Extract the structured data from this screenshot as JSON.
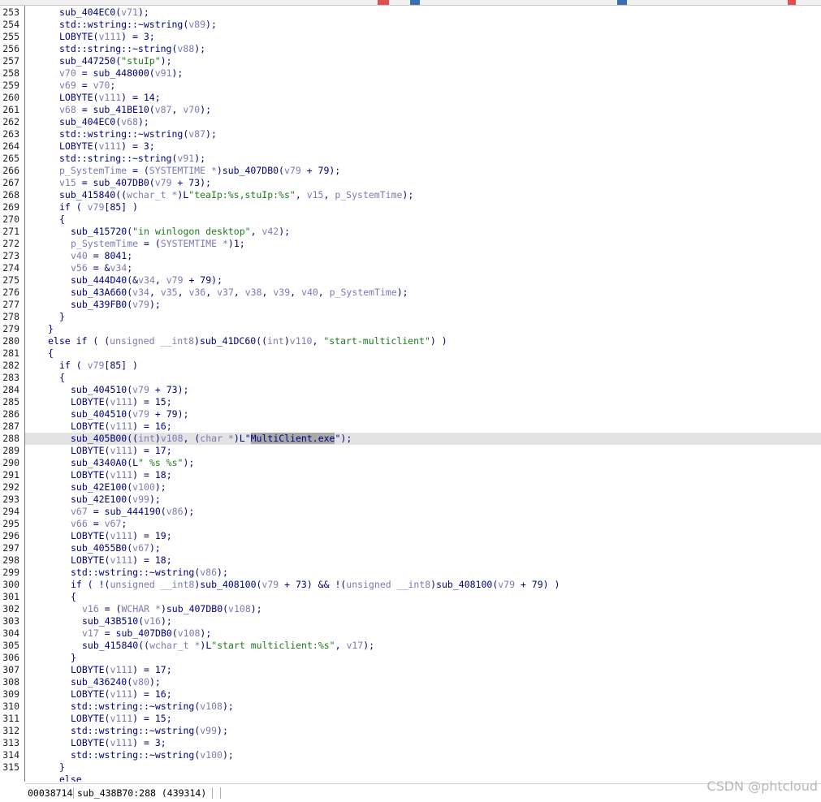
{
  "status": {
    "address": "00038714",
    "location": "sub_438B70:288 (439314)"
  },
  "watermark": "CSDN @phtcloud",
  "lines": [
    {
      "n": "253",
      "indent": 6,
      "toks": [
        [
          "fn",
          "sub_404EC0("
        ],
        [
          "var",
          "v71"
        ],
        [
          "op",
          ");"
        ]
      ]
    },
    {
      "n": "254",
      "indent": 6,
      "toks": [
        [
          "fn",
          "std::wstring::~wstring("
        ],
        [
          "var",
          "v89"
        ],
        [
          "op",
          ");"
        ]
      ]
    },
    {
      "n": "255",
      "indent": 6,
      "toks": [
        [
          "fn",
          "LOBYTE("
        ],
        [
          "var",
          "v111"
        ],
        [
          "op",
          ") = 3;"
        ]
      ]
    },
    {
      "n": "256",
      "indent": 6,
      "toks": [
        [
          "fn",
          "std::string::~string("
        ],
        [
          "var",
          "v88"
        ],
        [
          "op",
          ");"
        ]
      ]
    },
    {
      "n": "257",
      "indent": 6,
      "toks": [
        [
          "fn",
          "sub_447250("
        ],
        [
          "str",
          "\"stuIp\""
        ],
        [
          "op",
          ");"
        ]
      ]
    },
    {
      "n": "258",
      "indent": 6,
      "toks": [
        [
          "var",
          "v70"
        ],
        [
          "op",
          " = sub_448000("
        ],
        [
          "var",
          "v91"
        ],
        [
          "op",
          ");"
        ]
      ]
    },
    {
      "n": "259",
      "indent": 6,
      "toks": [
        [
          "var",
          "v69"
        ],
        [
          "op",
          " = "
        ],
        [
          "var",
          "v70"
        ],
        [
          "op",
          ";"
        ]
      ]
    },
    {
      "n": "260",
      "indent": 6,
      "toks": [
        [
          "fn",
          "LOBYTE("
        ],
        [
          "var",
          "v111"
        ],
        [
          "op",
          ") = 14;"
        ]
      ]
    },
    {
      "n": "261",
      "indent": 6,
      "toks": [
        [
          "var",
          "v68"
        ],
        [
          "op",
          " = sub_41BE10("
        ],
        [
          "var",
          "v87"
        ],
        [
          "op",
          ", "
        ],
        [
          "var",
          "v70"
        ],
        [
          "op",
          ");"
        ]
      ]
    },
    {
      "n": "262",
      "indent": 6,
      "toks": [
        [
          "fn",
          "sub_404EC0("
        ],
        [
          "var",
          "v68"
        ],
        [
          "op",
          ");"
        ]
      ]
    },
    {
      "n": "263",
      "indent": 6,
      "toks": [
        [
          "fn",
          "std::wstring::~wstring("
        ],
        [
          "var",
          "v87"
        ],
        [
          "op",
          ");"
        ]
      ]
    },
    {
      "n": "264",
      "indent": 6,
      "toks": [
        [
          "fn",
          "LOBYTE("
        ],
        [
          "var",
          "v111"
        ],
        [
          "op",
          ") = 3;"
        ]
      ]
    },
    {
      "n": "265",
      "indent": 6,
      "toks": [
        [
          "fn",
          "std::string::~string("
        ],
        [
          "var",
          "v91"
        ],
        [
          "op",
          ");"
        ]
      ]
    },
    {
      "n": "266",
      "indent": 6,
      "toks": [
        [
          "var",
          "p_SystemTime"
        ],
        [
          "op",
          " = ("
        ],
        [
          "type",
          "SYSTEMTIME *"
        ],
        [
          "op",
          ")sub_407DB0("
        ],
        [
          "var",
          "v79"
        ],
        [
          "op",
          " + 79);"
        ]
      ]
    },
    {
      "n": "267",
      "indent": 6,
      "toks": [
        [
          "var",
          "v15"
        ],
        [
          "op",
          " = sub_407DB0("
        ],
        [
          "var",
          "v79"
        ],
        [
          "op",
          " + 73);"
        ]
      ]
    },
    {
      "n": "268",
      "indent": 6,
      "toks": [
        [
          "fn",
          "sub_415840(("
        ],
        [
          "type",
          "wchar_t *"
        ],
        [
          "op",
          ")L"
        ],
        [
          "str",
          "\"teaIp:%s,stuIp:%s\""
        ],
        [
          "op",
          ", "
        ],
        [
          "var",
          "v15"
        ],
        [
          "op",
          ", "
        ],
        [
          "var",
          "p_SystemTime"
        ],
        [
          "op",
          ");"
        ]
      ]
    },
    {
      "n": "269",
      "indent": 6,
      "toks": [
        [
          "kw",
          "if ( "
        ],
        [
          "var",
          "v79"
        ],
        [
          "op",
          "[85] )"
        ]
      ]
    },
    {
      "n": "270",
      "indent": 6,
      "toks": [
        [
          "op",
          "{"
        ]
      ]
    },
    {
      "n": "271",
      "indent": 8,
      "toks": [
        [
          "fn",
          "sub_415720("
        ],
        [
          "str",
          "\"in winlogon desktop\""
        ],
        [
          "op",
          ", "
        ],
        [
          "var",
          "v42"
        ],
        [
          "op",
          ");"
        ]
      ]
    },
    {
      "n": "272",
      "indent": 8,
      "toks": [
        [
          "var",
          "p_SystemTime"
        ],
        [
          "op",
          " = ("
        ],
        [
          "type",
          "SYSTEMTIME *"
        ],
        [
          "op",
          ")1;"
        ]
      ]
    },
    {
      "n": "273",
      "indent": 8,
      "toks": [
        [
          "var",
          "v40"
        ],
        [
          "op",
          " = 8041;"
        ]
      ]
    },
    {
      "n": "274",
      "indent": 8,
      "toks": [
        [
          "var",
          "v56"
        ],
        [
          "op",
          " = &"
        ],
        [
          "var",
          "v34"
        ],
        [
          "op",
          ";"
        ]
      ]
    },
    {
      "n": "275",
      "indent": 8,
      "toks": [
        [
          "fn",
          "sub_444D40(&"
        ],
        [
          "var",
          "v34"
        ],
        [
          "op",
          ", "
        ],
        [
          "var",
          "v79"
        ],
        [
          "op",
          " + 79);"
        ]
      ]
    },
    {
      "n": "276",
      "indent": 8,
      "toks": [
        [
          "fn",
          "sub_43A660("
        ],
        [
          "var",
          "v34"
        ],
        [
          "op",
          ", "
        ],
        [
          "var",
          "v35"
        ],
        [
          "op",
          ", "
        ],
        [
          "var",
          "v36"
        ],
        [
          "op",
          ", "
        ],
        [
          "var",
          "v37"
        ],
        [
          "op",
          ", "
        ],
        [
          "var",
          "v38"
        ],
        [
          "op",
          ", "
        ],
        [
          "var",
          "v39"
        ],
        [
          "op",
          ", "
        ],
        [
          "var",
          "v40"
        ],
        [
          "op",
          ", "
        ],
        [
          "var",
          "p_SystemTime"
        ],
        [
          "op",
          ");"
        ]
      ]
    },
    {
      "n": "277",
      "indent": 8,
      "toks": [
        [
          "fn",
          "sub_439FB0("
        ],
        [
          "var",
          "v79"
        ],
        [
          "op",
          ");"
        ]
      ]
    },
    {
      "n": "278",
      "indent": 6,
      "toks": [
        [
          "op",
          "}"
        ]
      ]
    },
    {
      "n": "279",
      "indent": 4,
      "toks": [
        [
          "op",
          "}"
        ]
      ]
    },
    {
      "n": "280",
      "indent": 4,
      "toks": [
        [
          "kw",
          "else if ( ("
        ],
        [
          "type",
          "unsigned __int8"
        ],
        [
          "op",
          ")sub_41DC60(("
        ],
        [
          "type",
          "int"
        ],
        [
          "op",
          ")"
        ],
        [
          "var",
          "v110"
        ],
        [
          "op",
          ", "
        ],
        [
          "str",
          "\"start-multiclient\""
        ],
        [
          "op",
          ") )"
        ]
      ]
    },
    {
      "n": "281",
      "indent": 4,
      "toks": [
        [
          "op",
          "{"
        ]
      ]
    },
    {
      "n": "282",
      "indent": 6,
      "toks": [
        [
          "kw",
          "if ( "
        ],
        [
          "var",
          "v79"
        ],
        [
          "op",
          "[85] )"
        ]
      ]
    },
    {
      "n": "283",
      "indent": 6,
      "toks": [
        [
          "op",
          "{"
        ]
      ]
    },
    {
      "n": "284",
      "indent": 8,
      "toks": [
        [
          "fn",
          "sub_404510("
        ],
        [
          "var",
          "v79"
        ],
        [
          "op",
          " + 73);"
        ]
      ]
    },
    {
      "n": "285",
      "indent": 8,
      "toks": [
        [
          "fn",
          "LOBYTE("
        ],
        [
          "var",
          "v111"
        ],
        [
          "op",
          ") = 15;"
        ]
      ]
    },
    {
      "n": "286",
      "indent": 8,
      "toks": [
        [
          "fn",
          "sub_404510("
        ],
        [
          "var",
          "v79"
        ],
        [
          "op",
          " + 79);"
        ]
      ]
    },
    {
      "n": "287",
      "indent": 8,
      "toks": [
        [
          "fn",
          "LOBYTE("
        ],
        [
          "var",
          "v111"
        ],
        [
          "op",
          ") = 16;"
        ]
      ]
    },
    {
      "n": "288",
      "indent": 8,
      "cur": true,
      "toks": [
        [
          "fn",
          "sub_405B00(("
        ],
        [
          "type",
          "int"
        ],
        [
          "op",
          ")"
        ],
        [
          "var",
          "v108"
        ],
        [
          "op",
          ", ("
        ],
        [
          "type",
          "char *"
        ],
        [
          "op",
          ")L\""
        ],
        [
          "sel",
          "MultiClient.exe"
        ],
        [
          "op",
          "\");"
        ]
      ]
    },
    {
      "n": "289",
      "indent": 8,
      "toks": [
        [
          "fn",
          "LOBYTE("
        ],
        [
          "var",
          "v111"
        ],
        [
          "op",
          ") = 17;"
        ]
      ]
    },
    {
      "n": "290",
      "indent": 8,
      "toks": [
        [
          "fn",
          "sub_4340A0(L"
        ],
        [
          "str",
          "\" %s %s\""
        ],
        [
          "op",
          ");"
        ]
      ]
    },
    {
      "n": "291",
      "indent": 8,
      "toks": [
        [
          "fn",
          "LOBYTE("
        ],
        [
          "var",
          "v111"
        ],
        [
          "op",
          ") = 18;"
        ]
      ]
    },
    {
      "n": "292",
      "indent": 8,
      "toks": [
        [
          "fn",
          "sub_42E100("
        ],
        [
          "var",
          "v100"
        ],
        [
          "op",
          ");"
        ]
      ]
    },
    {
      "n": "293",
      "indent": 8,
      "toks": [
        [
          "fn",
          "sub_42E100("
        ],
        [
          "var",
          "v99"
        ],
        [
          "op",
          ");"
        ]
      ]
    },
    {
      "n": "294",
      "indent": 8,
      "toks": [
        [
          "var",
          "v67"
        ],
        [
          "op",
          " = sub_444190("
        ],
        [
          "var",
          "v86"
        ],
        [
          "op",
          ");"
        ]
      ]
    },
    {
      "n": "295",
      "indent": 8,
      "toks": [
        [
          "var",
          "v66"
        ],
        [
          "op",
          " = "
        ],
        [
          "var",
          "v67"
        ],
        [
          "op",
          ";"
        ]
      ]
    },
    {
      "n": "296",
      "indent": 8,
      "toks": [
        [
          "fn",
          "LOBYTE("
        ],
        [
          "var",
          "v111"
        ],
        [
          "op",
          ") = 19;"
        ]
      ]
    },
    {
      "n": "297",
      "indent": 8,
      "toks": [
        [
          "fn",
          "sub_4055B0("
        ],
        [
          "var",
          "v67"
        ],
        [
          "op",
          ");"
        ]
      ]
    },
    {
      "n": "298",
      "indent": 8,
      "toks": [
        [
          "fn",
          "LOBYTE("
        ],
        [
          "var",
          "v111"
        ],
        [
          "op",
          ") = 18;"
        ]
      ]
    },
    {
      "n": "299",
      "indent": 8,
      "toks": [
        [
          "fn",
          "std::wstring::~wstring("
        ],
        [
          "var",
          "v86"
        ],
        [
          "op",
          ");"
        ]
      ]
    },
    {
      "n": "300",
      "indent": 8,
      "toks": [
        [
          "kw",
          "if ( !("
        ],
        [
          "type",
          "unsigned __int8"
        ],
        [
          "op",
          ")sub_408100("
        ],
        [
          "var",
          "v79"
        ],
        [
          "op",
          " + 73) && !("
        ],
        [
          "type",
          "unsigned __int8"
        ],
        [
          "op",
          ")sub_408100("
        ],
        [
          "var",
          "v79"
        ],
        [
          "op",
          " + 79) )"
        ]
      ]
    },
    {
      "n": "301",
      "indent": 8,
      "toks": [
        [
          "op",
          "{"
        ]
      ]
    },
    {
      "n": "302",
      "indent": 10,
      "toks": [
        [
          "var",
          "v16"
        ],
        [
          "op",
          " = ("
        ],
        [
          "type",
          "WCHAR *"
        ],
        [
          "op",
          ")sub_407DB0("
        ],
        [
          "var",
          "v108"
        ],
        [
          "op",
          ");"
        ]
      ]
    },
    {
      "n": "303",
      "indent": 10,
      "toks": [
        [
          "fn",
          "sub_43B510("
        ],
        [
          "var",
          "v16"
        ],
        [
          "op",
          ");"
        ]
      ]
    },
    {
      "n": "304",
      "indent": 10,
      "toks": [
        [
          "var",
          "v17"
        ],
        [
          "op",
          " = sub_407DB0("
        ],
        [
          "var",
          "v108"
        ],
        [
          "op",
          ");"
        ]
      ]
    },
    {
      "n": "305",
      "indent": 10,
      "toks": [
        [
          "fn",
          "sub_415840(("
        ],
        [
          "type",
          "wchar_t *"
        ],
        [
          "op",
          ")L"
        ],
        [
          "str",
          "\"start multiclient:%s\""
        ],
        [
          "op",
          ", "
        ],
        [
          "var",
          "v17"
        ],
        [
          "op",
          ");"
        ]
      ]
    },
    {
      "n": "306",
      "indent": 8,
      "toks": [
        [
          "op",
          "}"
        ]
      ]
    },
    {
      "n": "307",
      "indent": 8,
      "toks": [
        [
          "fn",
          "LOBYTE("
        ],
        [
          "var",
          "v111"
        ],
        [
          "op",
          ") = 17;"
        ]
      ]
    },
    {
      "n": "308",
      "indent": 8,
      "toks": [
        [
          "fn",
          "sub_436240("
        ],
        [
          "var",
          "v80"
        ],
        [
          "op",
          ");"
        ]
      ]
    },
    {
      "n": "309",
      "indent": 8,
      "toks": [
        [
          "fn",
          "LOBYTE("
        ],
        [
          "var",
          "v111"
        ],
        [
          "op",
          ") = 16;"
        ]
      ]
    },
    {
      "n": "310",
      "indent": 8,
      "toks": [
        [
          "fn",
          "std::wstring::~wstring("
        ],
        [
          "var",
          "v108"
        ],
        [
          "op",
          ");"
        ]
      ]
    },
    {
      "n": "311",
      "indent": 8,
      "toks": [
        [
          "fn",
          "LOBYTE("
        ],
        [
          "var",
          "v111"
        ],
        [
          "op",
          ") = 15;"
        ]
      ]
    },
    {
      "n": "312",
      "indent": 8,
      "toks": [
        [
          "fn",
          "std::wstring::~wstring("
        ],
        [
          "var",
          "v99"
        ],
        [
          "op",
          ");"
        ]
      ]
    },
    {
      "n": "313",
      "indent": 8,
      "toks": [
        [
          "fn",
          "LOBYTE("
        ],
        [
          "var",
          "v111"
        ],
        [
          "op",
          ") = 3;"
        ]
      ]
    },
    {
      "n": "314",
      "indent": 8,
      "toks": [
        [
          "fn",
          "std::wstring::~wstring("
        ],
        [
          "var",
          "v100"
        ],
        [
          "op",
          ");"
        ]
      ]
    },
    {
      "n": "315",
      "indent": 6,
      "toks": [
        [
          "op",
          "}"
        ]
      ]
    },
    {
      "n": "",
      "indent": 6,
      "toks": [
        [
          "kw",
          "else"
        ]
      ]
    }
  ]
}
